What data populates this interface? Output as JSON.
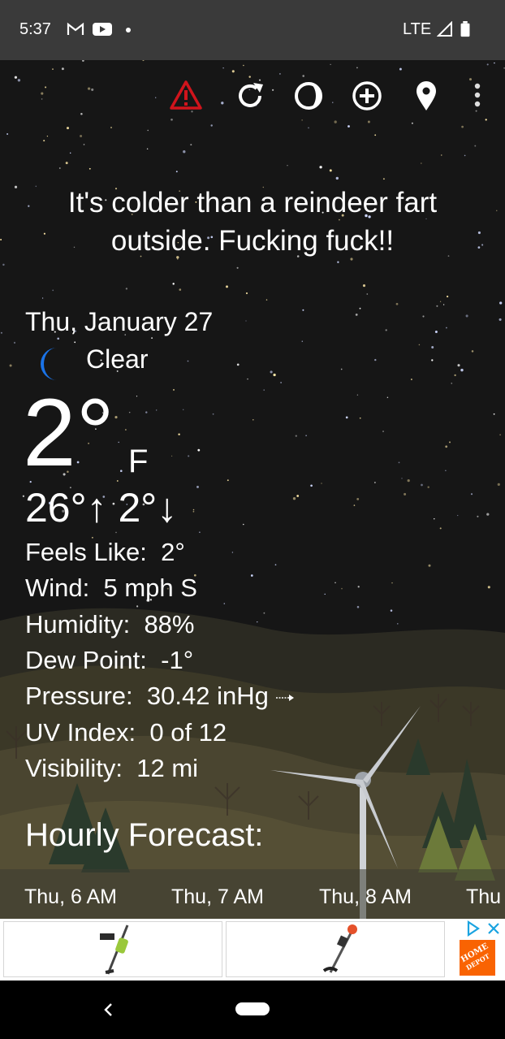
{
  "status_bar": {
    "time": "5:37",
    "network": "LTE",
    "icons": [
      "gmail-icon",
      "youtube-icon",
      "notification-dot-icon",
      "signal-icon",
      "battery-icon"
    ]
  },
  "toolbar": {
    "icons": [
      "alert-icon",
      "refresh-icon",
      "theme-icon",
      "add-location-icon",
      "location-pin-icon",
      "overflow-menu-icon"
    ],
    "alert_color": "#d0141c"
  },
  "headline": "It's colder than a reindeer fart outside. Fucking fuck!!",
  "current": {
    "date": "Thu, January 27",
    "condition": "Clear",
    "condition_icon": "moon-icon",
    "temperature": "2°",
    "unit": "F",
    "high_low": "26°↑ 2°↓"
  },
  "details": [
    {
      "label": "Feels Like:",
      "value": "2°"
    },
    {
      "label": "Wind:",
      "value": "5 mph S"
    },
    {
      "label": "Humidity:",
      "value": "88%"
    },
    {
      "label": "Dew Point:",
      "value": "-1°"
    },
    {
      "label": "Pressure:",
      "value": "30.42 inHg"
    },
    {
      "label": "UV Index:",
      "value": "0 of 12"
    },
    {
      "label": "Visibility:",
      "value": "12 mi"
    }
  ],
  "pressure_trend_icon": "arrow-right-icon",
  "hourly": {
    "title": "Hourly Forecast:",
    "hours": [
      "Thu, 6 AM",
      "Thu, 7 AM",
      "Thu, 8 AM",
      "Thu"
    ]
  },
  "ad": {
    "brand": "THE HOME DEPOT",
    "brand_color": "#f96302",
    "items": [
      "string-trimmer-1",
      "string-trimmer-2"
    ],
    "icons": [
      "ad-choices-icon",
      "close-ad-icon"
    ]
  },
  "nav_bar": {
    "icons": [
      "back-icon",
      "home-pill-icon"
    ]
  },
  "colors": {
    "sky": "#161616",
    "moon": "#1a73e8",
    "status_bar": "#3a3a3a"
  }
}
